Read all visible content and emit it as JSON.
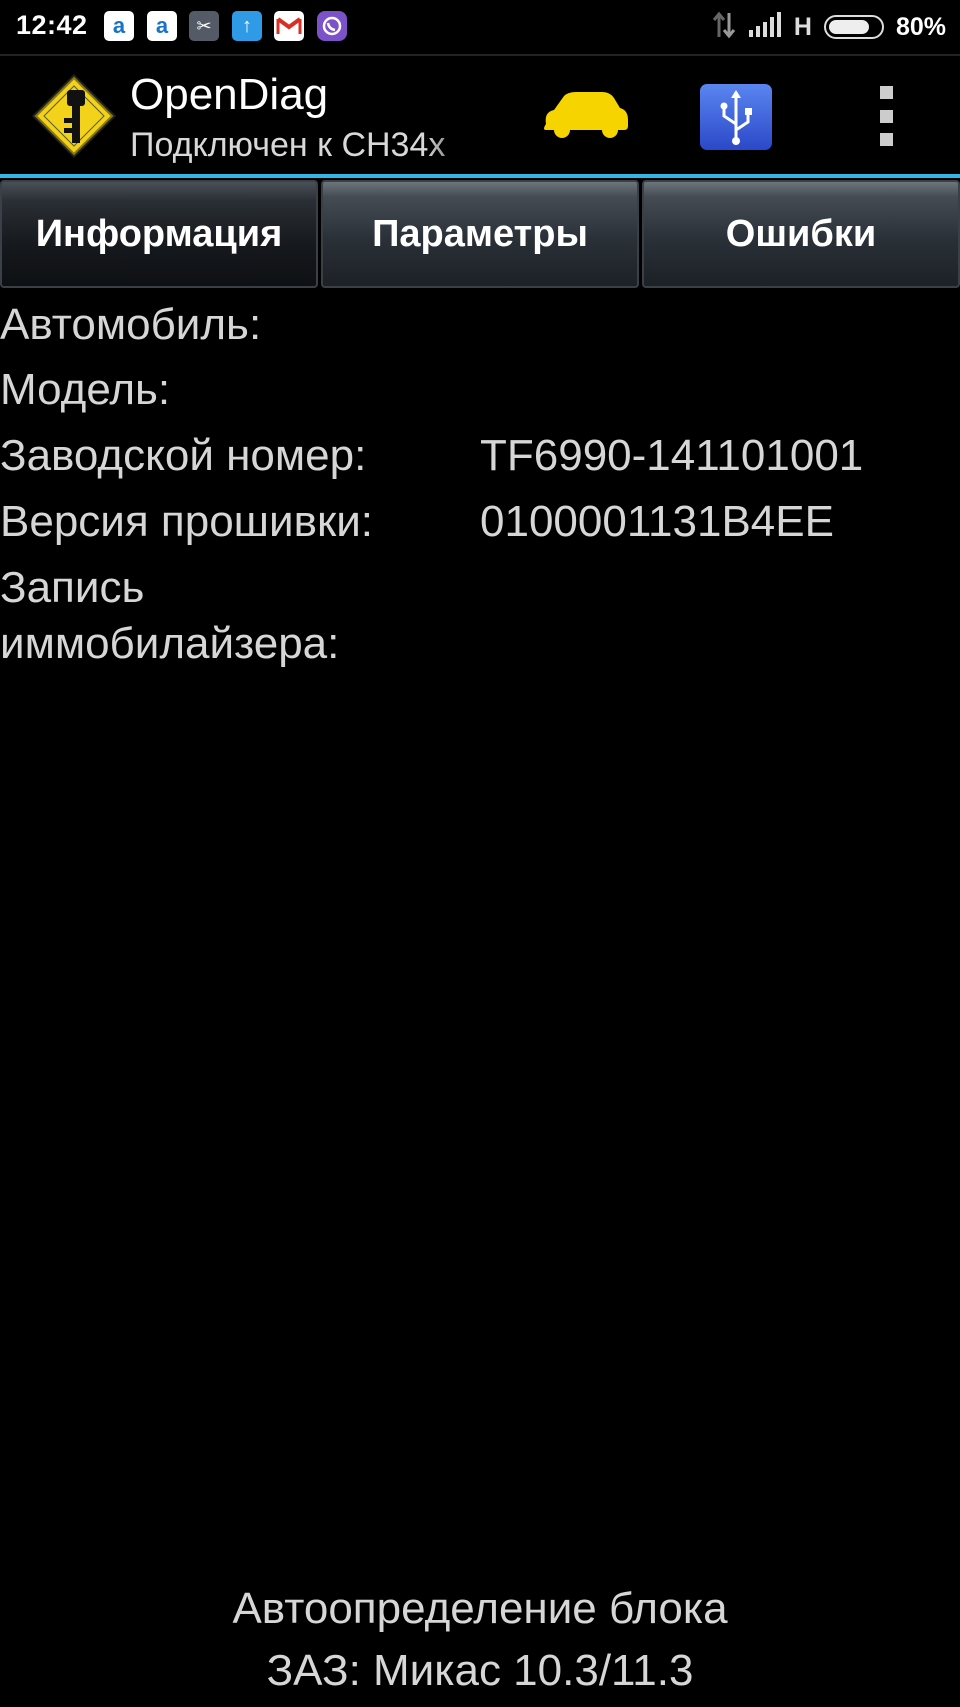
{
  "status_bar": {
    "time": "12:42",
    "notifications": [
      "a-app-icon",
      "a-app-icon",
      "scissors-icon",
      "upload-icon",
      "gmail-icon",
      "viber-icon"
    ],
    "network_type": "H",
    "battery_percent": 80,
    "battery_text": "80%"
  },
  "app_bar": {
    "title": "OpenDiag",
    "subtitle": "Подключен к CH34x",
    "logo_icon": "key-warning-sign-icon",
    "car_icon_color": "#f5d400",
    "usb_icon_color": "#3a5fd6",
    "accent_color": "#33b5e5"
  },
  "tabs": [
    {
      "label": "Информация",
      "active": true
    },
    {
      "label": "Параметры",
      "active": false
    },
    {
      "label": "Ошибки",
      "active": false
    }
  ],
  "info": {
    "rows": [
      {
        "label": "Автомобиль:",
        "value": ""
      },
      {
        "label": "Модель:",
        "value": ""
      },
      {
        "label": "Заводской номер:",
        "value": "TF6990-141101001"
      },
      {
        "label": "Версия прошивки:",
        "value": "0100001131B4EE"
      },
      {
        "label": "Запись иммобилайзера:",
        "value": ""
      }
    ]
  },
  "footer": {
    "line1": "Автоопределение блока",
    "line2": "ЗАЗ: Микас 10.3/11.3"
  }
}
